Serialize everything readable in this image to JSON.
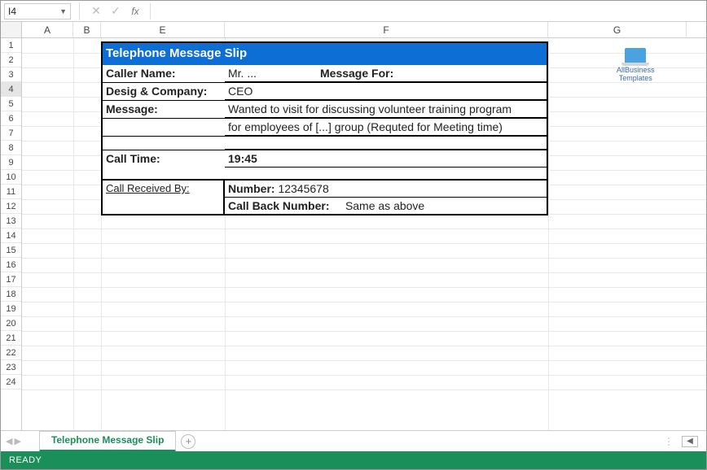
{
  "formula_bar": {
    "name_box": "I4"
  },
  "columns": [
    "A",
    "B",
    "E",
    "F",
    "G"
  ],
  "rows": [
    1,
    2,
    3,
    4,
    5,
    6,
    7,
    8,
    9,
    10,
    11,
    12,
    13,
    14,
    15,
    16,
    17,
    18,
    19,
    20,
    21,
    22,
    23,
    24
  ],
  "active_row": 4,
  "slip": {
    "title": "Telephone Message Slip",
    "caller_name_label": "Caller Name:",
    "caller_name_value": "Mr. ...",
    "message_for_label": "Message For:",
    "desig_label": "Desig & Company:",
    "desig_value": "CEO",
    "message_label": "Message:",
    "message_line1": "Wanted to visit for discussing volunteer training program",
    "message_line2": "for employees of [...] group (Requted for Meeting time)",
    "call_time_label": "Call Time:",
    "call_time_value": "19:45",
    "received_by_label": "Call Received By:",
    "number_label": "Number:",
    "number_value": "12345678",
    "callback_label": "Call Back Number:",
    "callback_value": "Same as above"
  },
  "logo": {
    "line1": "AllBusiness",
    "line2": "Templates"
  },
  "tabs": {
    "sheet1": "Telephone Message Slip"
  },
  "status": {
    "ready": "READY"
  }
}
